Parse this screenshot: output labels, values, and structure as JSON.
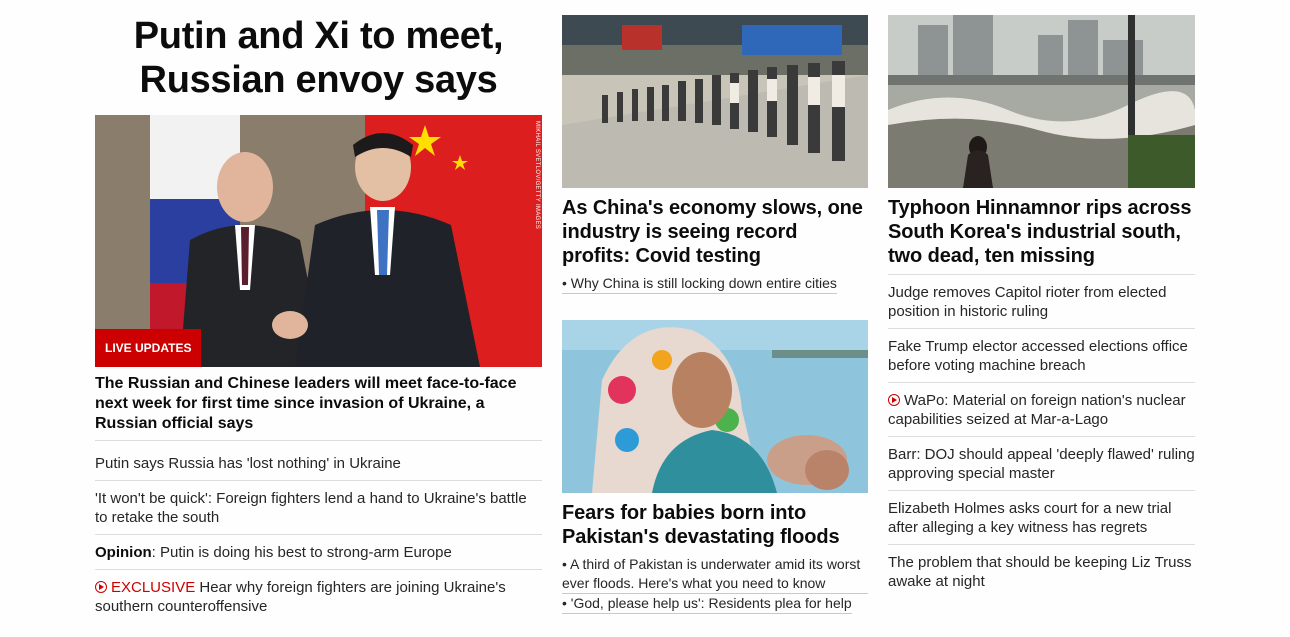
{
  "left": {
    "headline": "Putin and Xi to meet, Russian envoy says",
    "badge": "LIVE UPDATES",
    "photo_credit": "MIKHAIL SVETLOV/GETTY IMAGES",
    "lead": "The Russian and Chinese leaders will meet face-to-face next week for first time since invasion of Ukraine, a Russian official says",
    "stories": [
      "Putin says Russia has 'lost nothing' in Ukraine",
      "'It won't be quick': Foreign fighters lend a hand to Ukraine's battle to retake the south"
    ],
    "opinion_label": "Opinion",
    "opinion_text": ": Putin is doing his best to strong-arm Europe",
    "exclusive_label": "EXCLUSIVE",
    "exclusive_text": " Hear why foreign fighters are joining Ukraine's southern counteroffensive",
    "colors": {
      "accent": "#cc0000"
    }
  },
  "middle": {
    "card1": {
      "headline": "As China's economy slows, one industry is seeing record profits: Covid testing",
      "sublinks": [
        "Why China is still locking down entire cities"
      ]
    },
    "card2": {
      "headline": "Fears for babies born into Pakistan's devastating floods",
      "sublinks": [
        "A third of Pakistan is underwater amid its worst ever floods. Here's what you need to know",
        "'God, please help us': Residents plea for help"
      ]
    }
  },
  "right": {
    "headline": "Typhoon Hinnamnor rips across South Korea's industrial south, two dead, ten missing",
    "stories": [
      "Judge removes Capitol rioter from elected position in historic ruling",
      "Fake Trump elector accessed elections office before voting machine breach",
      "WaPo: Material on foreign nation's nuclear capabilities seized at Mar-a-Lago",
      "Barr: DOJ should appeal 'deeply flawed' ruling approving special master",
      "Elizabeth Holmes asks court for a new trial after alleging a key witness has regrets",
      "The problem that should be keeping Liz Truss awake at night"
    ]
  }
}
